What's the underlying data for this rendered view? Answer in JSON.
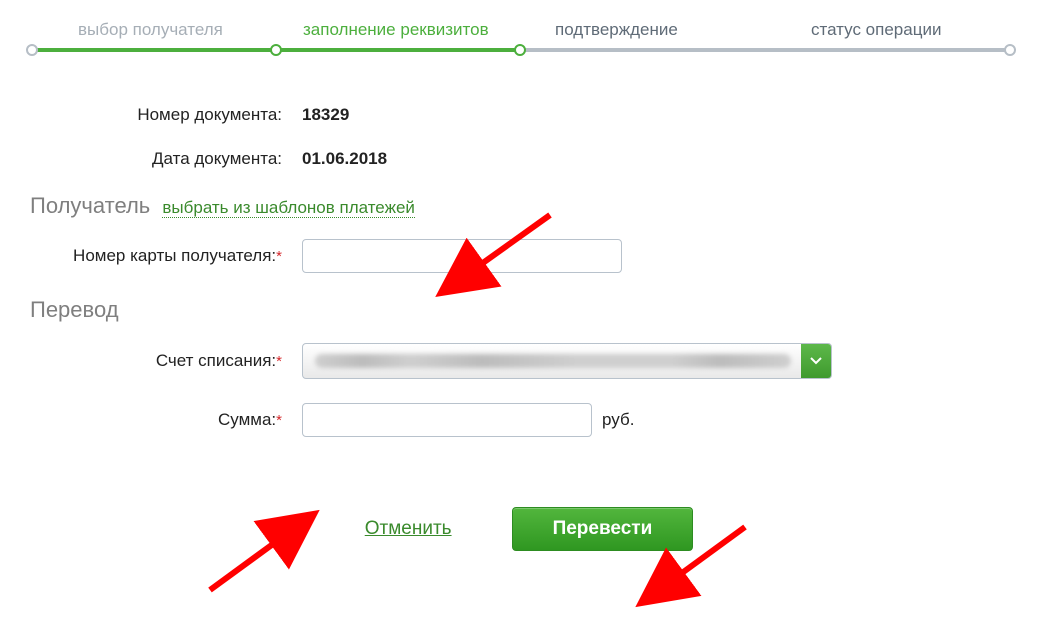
{
  "stepper": {
    "steps": [
      "выбор получателя",
      "заполнение реквизитов",
      "подтверждение",
      "статус операции"
    ],
    "active_index": 1
  },
  "doc": {
    "number_label": "Номер документа:",
    "number_value": "18329",
    "date_label": "Дата документа:",
    "date_value": "01.06.2018"
  },
  "recipient": {
    "title": "Получатель",
    "template_link": "выбрать из шаблонов платежей",
    "card_label": "Номер карты получателя:",
    "card_value": ""
  },
  "transfer": {
    "title": "Перевод",
    "account_label": "Счет списания:",
    "account_display": "",
    "amount_label": "Сумма:",
    "amount_value": "",
    "amount_unit": "руб."
  },
  "actions": {
    "cancel": "Отменить",
    "submit": "Перевести"
  }
}
